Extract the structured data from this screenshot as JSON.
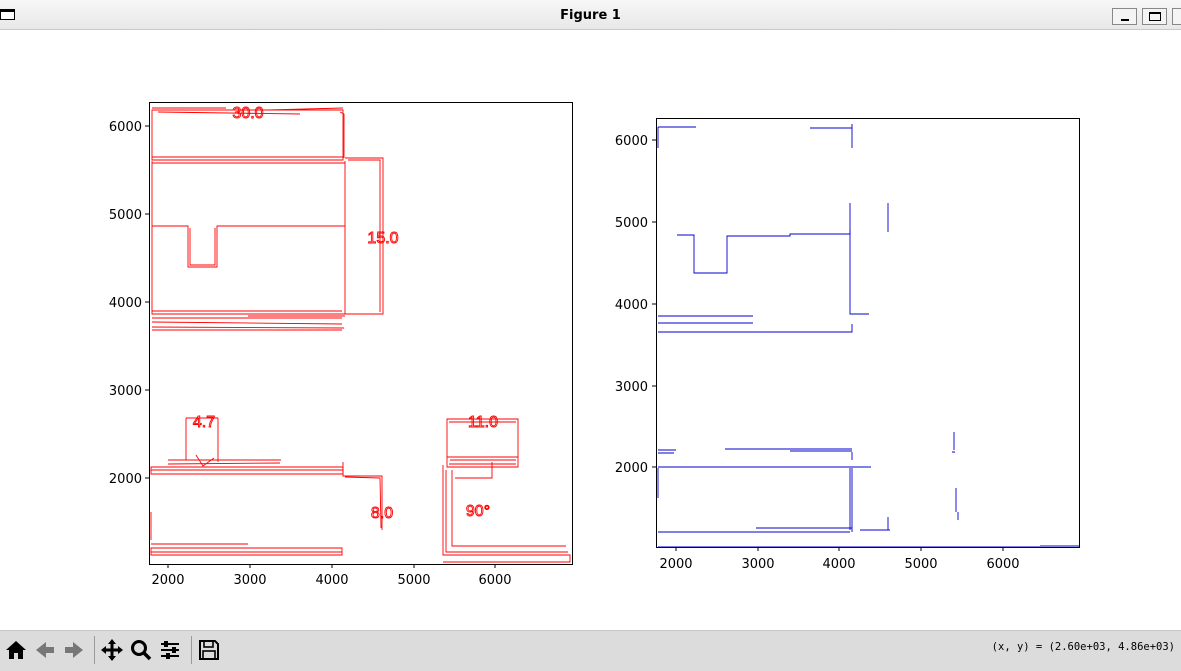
{
  "window": {
    "title": "Figure 1"
  },
  "figure": {
    "left_plot": {
      "color": "#ff0000",
      "xticks": [
        "2000",
        "3000",
        "4000",
        "5000",
        "6000"
      ],
      "yticks": [
        "2000",
        "3000",
        "4000",
        "5000",
        "6000"
      ],
      "annotations": [
        "30.0",
        "15.0",
        "4.7",
        "11.0",
        "8.0",
        "90°"
      ]
    },
    "right_plot": {
      "color": "#0000cc",
      "xticks": [
        "2000",
        "3000",
        "4000",
        "5000",
        "6000"
      ],
      "yticks": [
        "2000",
        "3000",
        "4000",
        "5000",
        "6000"
      ]
    }
  },
  "toolbar": {
    "icons": [
      "home-icon",
      "back-icon",
      "forward-icon",
      "pan-icon",
      "zoom-icon",
      "configure-subplots-icon",
      "save-icon"
    ],
    "coordinate_readout": "(x, y) = (2.60e+03, 4.86e+03)"
  }
}
